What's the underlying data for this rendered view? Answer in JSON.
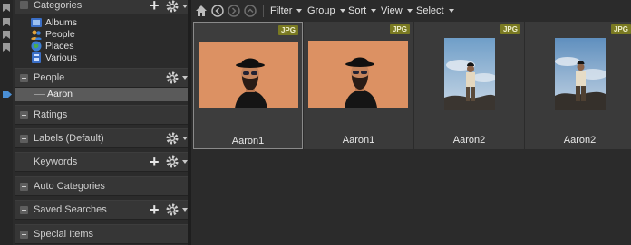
{
  "sidebar": {
    "categories": {
      "title": "Categories",
      "items": [
        {
          "label": "Albums",
          "icon": "albums-icon"
        },
        {
          "label": "People",
          "icon": "people-icon"
        },
        {
          "label": "Places",
          "icon": "places-icon"
        },
        {
          "label": "Various",
          "icon": "various-icon"
        }
      ]
    },
    "people": {
      "title": "People",
      "items": [
        "Aaron"
      ]
    },
    "ratings": {
      "title": "Ratings"
    },
    "labels": {
      "title": "Labels (Default)"
    },
    "keywords": {
      "title": "Keywords"
    },
    "auto_categories": {
      "title": "Auto Categories"
    },
    "saved_searches": {
      "title": "Saved Searches"
    },
    "special_items": {
      "title": "Special Items"
    }
  },
  "toolbar": {
    "menus": [
      "Filter",
      "Group",
      "Sort",
      "View",
      "Select"
    ]
  },
  "thumbnails": [
    {
      "name": "Aaron1",
      "badge": "JPG"
    },
    {
      "name": "Aaron1",
      "badge": "JPG"
    },
    {
      "name": "Aaron2",
      "badge": "JPG"
    },
    {
      "name": "Aaron2",
      "badge": "JPG"
    }
  ],
  "colors": {
    "badge": "#7a7a22",
    "selected_row": "#5a5a5a",
    "accent": "#4a8fd6"
  }
}
